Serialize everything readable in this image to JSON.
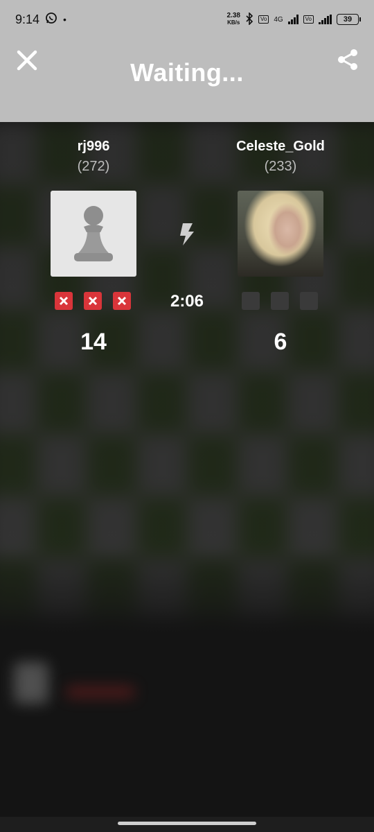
{
  "status_bar": {
    "time": "9:14",
    "speed_value": "2.38",
    "speed_unit": "KB/s",
    "network_label": "4G",
    "battery": "39"
  },
  "header": {
    "title": "Waiting..."
  },
  "match": {
    "timer": "2:06",
    "player_left": {
      "name": "rj996",
      "rating": "(272)",
      "score": "14",
      "marks": [
        "x",
        "x",
        "x"
      ]
    },
    "player_right": {
      "name": "Celeste_Gold",
      "rating": "(233)",
      "score": "6",
      "marks": [
        "empty",
        "empty",
        "empty"
      ]
    }
  },
  "icons": {
    "close": "close-icon",
    "share": "share-icon",
    "bolt": "lightning-icon",
    "pawn": "pawn-icon"
  },
  "colors": {
    "header_bg": "#bdbdbd",
    "mark_x": "#d9353a",
    "mark_empty": "#3a3a3a",
    "background": "#141414"
  }
}
